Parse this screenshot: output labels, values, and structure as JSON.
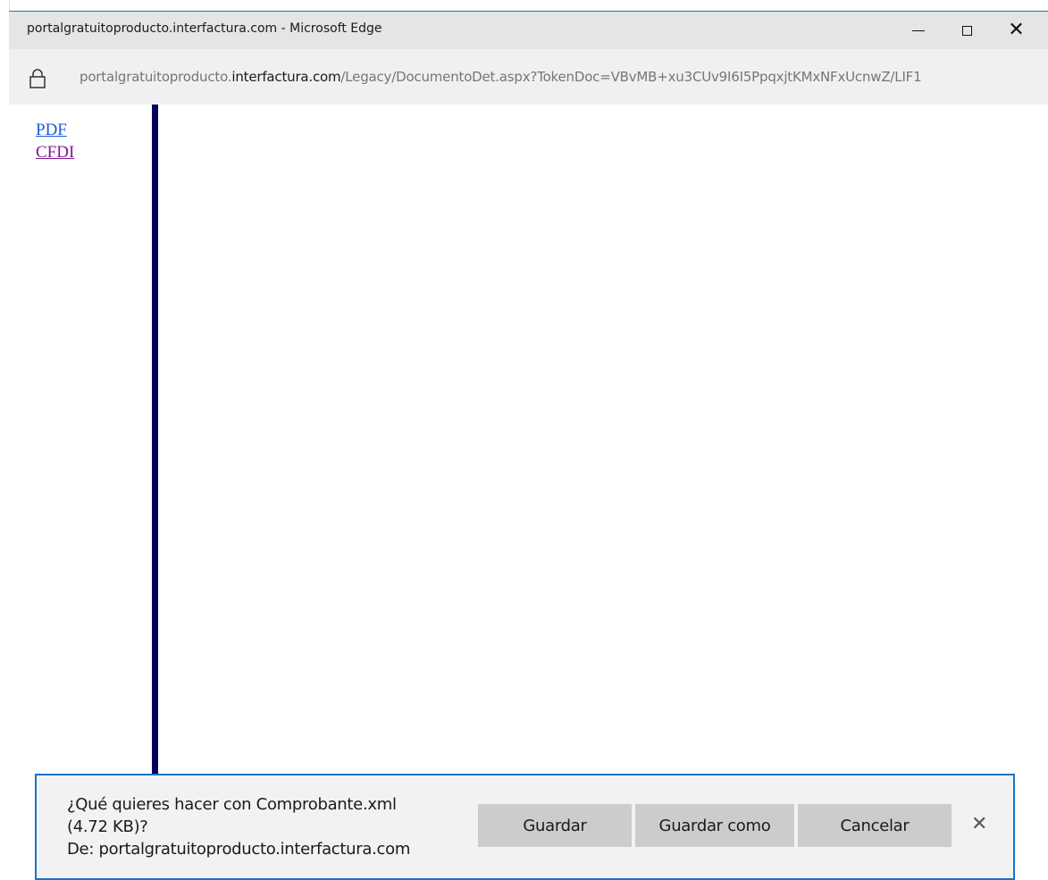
{
  "window": {
    "title": "portalgratuitoproducto.interfactura.com - Microsoft Edge",
    "minimize_icon": "minimize-icon",
    "maximize_icon": "maximize-icon",
    "close_icon": "close-icon"
  },
  "address": {
    "lock_icon": "lock-icon",
    "url_prefix": "portalgratuitoproducto.",
    "url_domain": "interfactura.com",
    "url_path": "/Legacy/DocumentoDet.aspx?TokenDoc=VBvMB+xu3CUv9I6I5PpqxjtKMxNFxUcnwZ/LIF1"
  },
  "frame_left": {
    "links": [
      {
        "label": "PDF",
        "color": "#1a5bd8"
      },
      {
        "label": "CFDI",
        "color": "#7f1a8e"
      }
    ],
    "divider_color": "#00005e"
  },
  "download_bar": {
    "line1": "¿Qué quieres hacer con Comprobante.xml",
    "line2": "(4.72 KB)?",
    "line3": "De: portalgratuitoproducto.interfactura.com",
    "save_label": "Guardar",
    "save_as_label": "Guardar como",
    "cancel_label": "Cancelar",
    "close_glyph": "✕",
    "accent_color": "#1a73c8"
  }
}
